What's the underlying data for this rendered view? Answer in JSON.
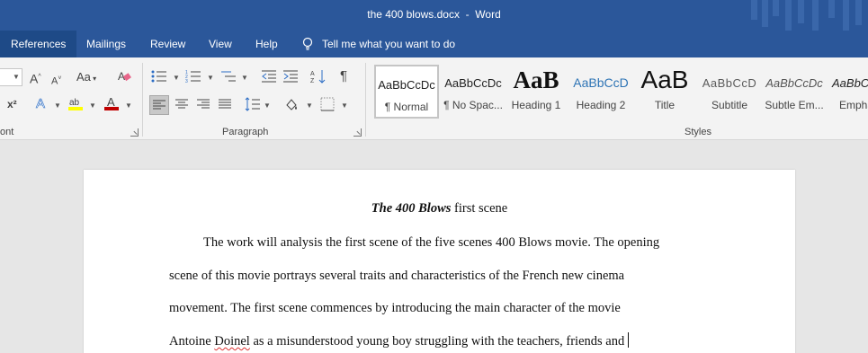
{
  "window": {
    "title": "the 400 blows.docx  -  Word"
  },
  "ribbon_tabs": [
    {
      "label": "References",
      "active": true
    },
    {
      "label": "Mailings"
    },
    {
      "label": "Review"
    },
    {
      "label": "View"
    },
    {
      "label": "Help"
    }
  ],
  "tell_me": "Tell me what you want to do",
  "font_group": {
    "label": "ont",
    "grow_font": "A",
    "shrink_font": "A",
    "change_case": "Aa",
    "superscript": "x²",
    "text_effects": "A",
    "font_color": "A"
  },
  "paragraph_group": {
    "label": "Paragraph",
    "show_marks": "¶"
  },
  "styles_group": {
    "label": "Styles",
    "items": [
      {
        "sample": "AaBbCcDc",
        "name": "¶ Normal"
      },
      {
        "sample": "AaBbCcDc",
        "name": "¶ No Spac..."
      },
      {
        "sample": "AaB",
        "name": "Heading 1"
      },
      {
        "sample": "AaBbCcD",
        "name": "Heading 2"
      },
      {
        "sample": "AaB",
        "name": "Title"
      },
      {
        "sample": "AaBbCcD",
        "name": "Subtitle"
      },
      {
        "sample": "AaBbCcDc",
        "name": "Subtle Em..."
      },
      {
        "sample": "AaBbCcDc",
        "name": "Empha"
      }
    ]
  },
  "colors": {
    "accent": "#2b579a",
    "highlight": "#ffff00",
    "font_color": "#c00000"
  },
  "document": {
    "title_italic": "The 400 Blows",
    "title_rest": " first scene",
    "lines": [
      "The work will analysis the first scene of the five scenes 400 Blows movie. The opening",
      "scene of this movie portrays several traits and characteristics of the French new cinema",
      "movement. The first scene commences by introducing the main character of the movie"
    ],
    "line4_a": "Antoine ",
    "line4_misspelled": "Doinel",
    "line4_b": " as a misunderstood young boy struggling with the teachers, friends and"
  }
}
